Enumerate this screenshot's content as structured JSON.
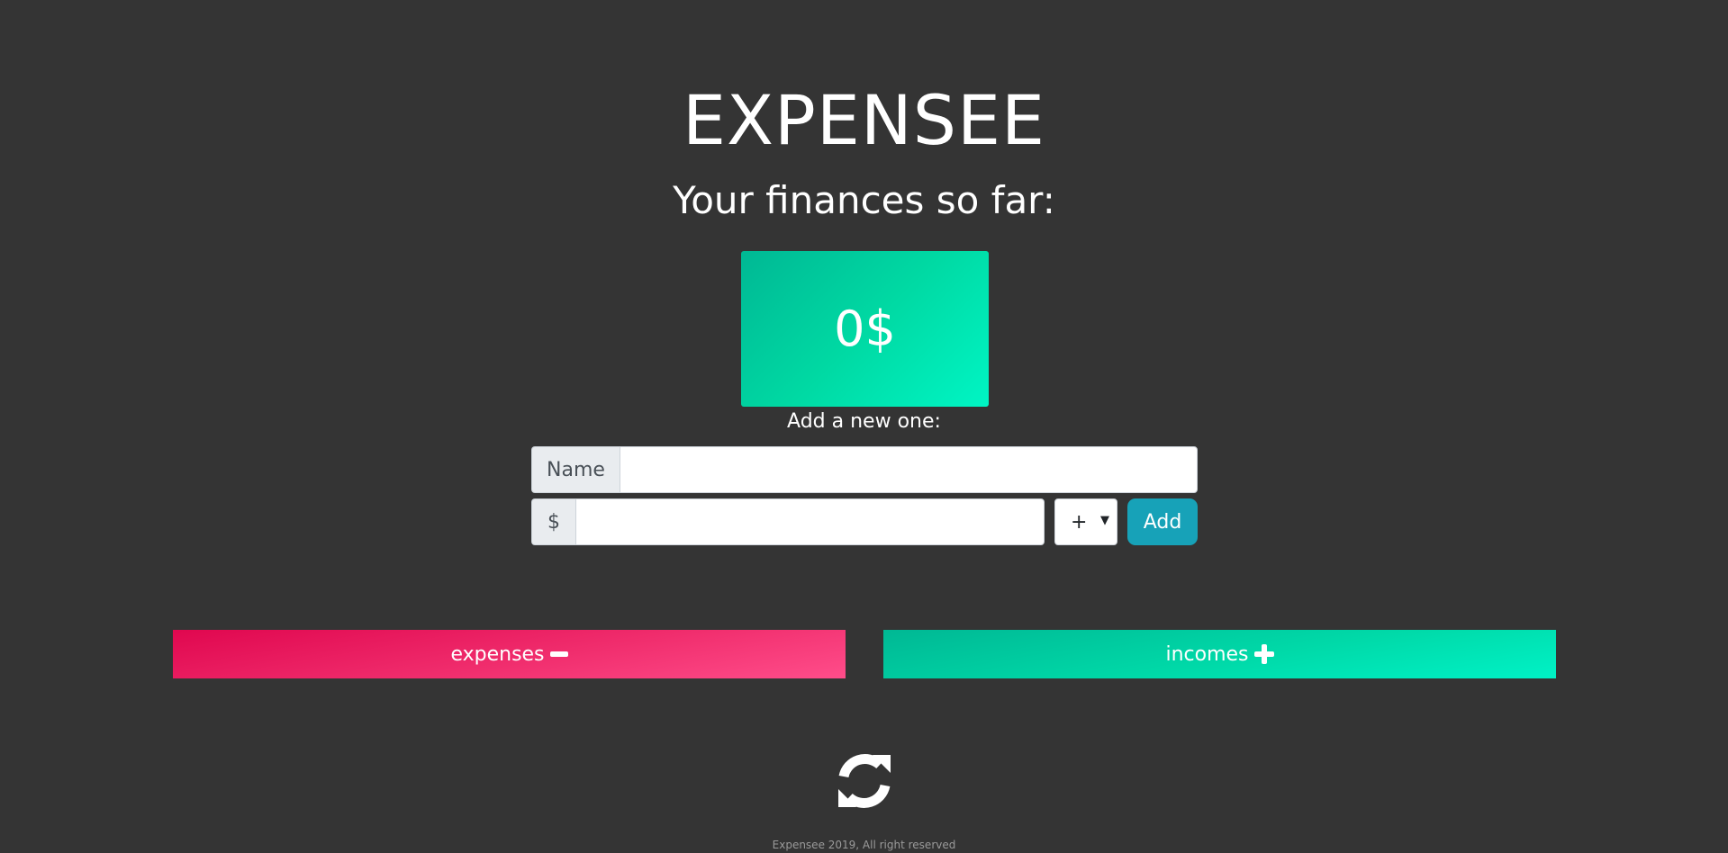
{
  "app": {
    "title": "EXPENSEE",
    "subtitle": "Your finances so far:"
  },
  "balance": {
    "display": "0$"
  },
  "form": {
    "heading": "Add a new one:",
    "name_addon": "Name",
    "name_value": "",
    "amount_addon": "$",
    "amount_value": "",
    "sign_selected": "+",
    "add_label": "Add"
  },
  "toggles": {
    "expenses_label": "expenses",
    "incomes_label": "incomes"
  },
  "footer": {
    "text": "Expensee 2019, All right reserved"
  },
  "icons": {
    "expenses": "minus-icon",
    "incomes": "plus-icon",
    "refresh": "refresh-icon"
  },
  "colors": {
    "background": "#343434",
    "balance": "#00d9a3",
    "expenses": "#f02d6d",
    "incomes": "#00d9a8",
    "add_button": "#17a2b8"
  }
}
